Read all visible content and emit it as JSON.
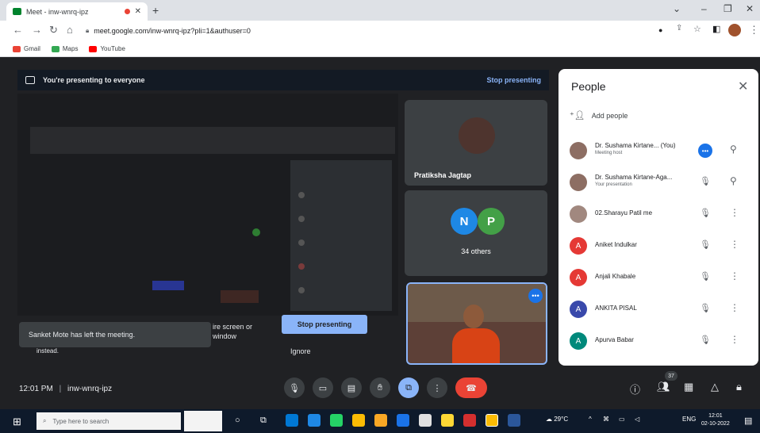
{
  "browser": {
    "tab_title": "Meet - inw-wnrq-ipz",
    "url": "meet.google.com/inw-wnrq-ipz?pli=1&authuser=0",
    "bookmarks": [
      {
        "label": "Gmail",
        "icon": "gmail-icon",
        "color": "#ea4335"
      },
      {
        "label": "Maps",
        "icon": "maps-icon",
        "color": "#34a853"
      },
      {
        "label": "YouTube",
        "icon": "youtube-icon",
        "color": "#ff0000"
      }
    ]
  },
  "meet": {
    "presenting_banner": "You're presenting to everyone",
    "stop_presenting_link": "Stop presenting",
    "tiles": {
      "pratiksha": "Pratiksha Jagtap",
      "others_count": "34 others",
      "initial_n": "N",
      "initial_p": "P"
    },
    "toast": "Sanket Mote has left the meeting.",
    "share_dialog": {
      "line1": "ire screen or",
      "line2": "window",
      "line3": "instead.",
      "stop_button": "Stop presenting",
      "ignore": "Ignore"
    },
    "footer": {
      "time": "12:01 PM",
      "separator": "|",
      "meeting_code": "inw-wnrq-ipz",
      "participant_count": "37"
    }
  },
  "people_panel": {
    "title": "People",
    "add_people": "Add people",
    "participants": [
      {
        "name": "Dr. Sushama Kirtane... (You)",
        "sub": "Meeting host",
        "initial": "",
        "color": "#8d6e63"
      },
      {
        "name": "Dr. Sushama Kirtane-Aga...",
        "sub": "Your presentation",
        "initial": "",
        "color": "#8d6e63"
      },
      {
        "name": "02.Sharayu Patil me",
        "sub": "",
        "initial": "",
        "color": "#a1887f"
      },
      {
        "name": "Aniket Indulkar",
        "sub": "",
        "initial": "A",
        "color": "#e53935"
      },
      {
        "name": "Anjali Khabale",
        "sub": "",
        "initial": "A",
        "color": "#e53935"
      },
      {
        "name": "ANKITA PISAL",
        "sub": "",
        "initial": "A",
        "color": "#3949ab"
      },
      {
        "name": "Apurva Babar",
        "sub": "",
        "initial": "A",
        "color": "#00897b"
      }
    ]
  },
  "taskbar": {
    "search_placeholder": "Type here to search",
    "weather": "29°C",
    "language": "ENG",
    "time": "12:01",
    "date": "02-10-2022"
  }
}
